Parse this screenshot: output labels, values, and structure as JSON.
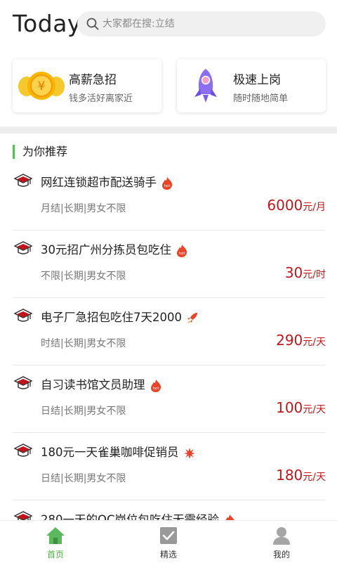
{
  "header": {
    "logo": "Today",
    "search": {
      "placeholder": "大家都在搜:立结"
    }
  },
  "cards": [
    {
      "title": "高薪急招",
      "subtitle": "钱多活好离家近",
      "icon": "coins-icon"
    },
    {
      "title": "极速上岗",
      "subtitle": "随时随地简单",
      "icon": "rocket-icon"
    }
  ],
  "section": {
    "title": "为你推荐"
  },
  "jobs": [
    {
      "title": "网红连锁超市配送骑手",
      "badge": "hot",
      "tags": "月结|长期|男女不限",
      "amount": "6000",
      "unit": "元/月"
    },
    {
      "title": "30元招广州分拣员包吃住",
      "badge": "hot",
      "tags": "不限|长期|男女不限",
      "amount": "30",
      "unit": "元/时"
    },
    {
      "title": "电子厂急招包吃住7天2000",
      "badge": "rocket",
      "tags": "时结|长期|男女不限",
      "amount": "290",
      "unit": "元/天"
    },
    {
      "title": "自习读书馆文员助理",
      "badge": "hot",
      "tags": "日结|长期|男女不限",
      "amount": "100",
      "unit": "元/天"
    },
    {
      "title": "180元一天雀巢咖啡促销员",
      "badge": "burst",
      "tags": "日结|长期|男女不限",
      "amount": "180",
      "unit": "元/天"
    },
    {
      "title": "280一天的QC岗位包吃住无需经验",
      "badge": "hot",
      "tags": "",
      "amount": "",
      "unit": ""
    }
  ],
  "tabbar": {
    "items": [
      {
        "label": "首页",
        "icon": "home-icon",
        "active": true
      },
      {
        "label": "精选",
        "icon": "checkbox-icon",
        "active": false
      },
      {
        "label": "我的",
        "icon": "person-icon",
        "active": false
      }
    ]
  },
  "colors": {
    "accent": "#4caf3c",
    "salary": "#c0161b",
    "hot": "#e8442a"
  }
}
